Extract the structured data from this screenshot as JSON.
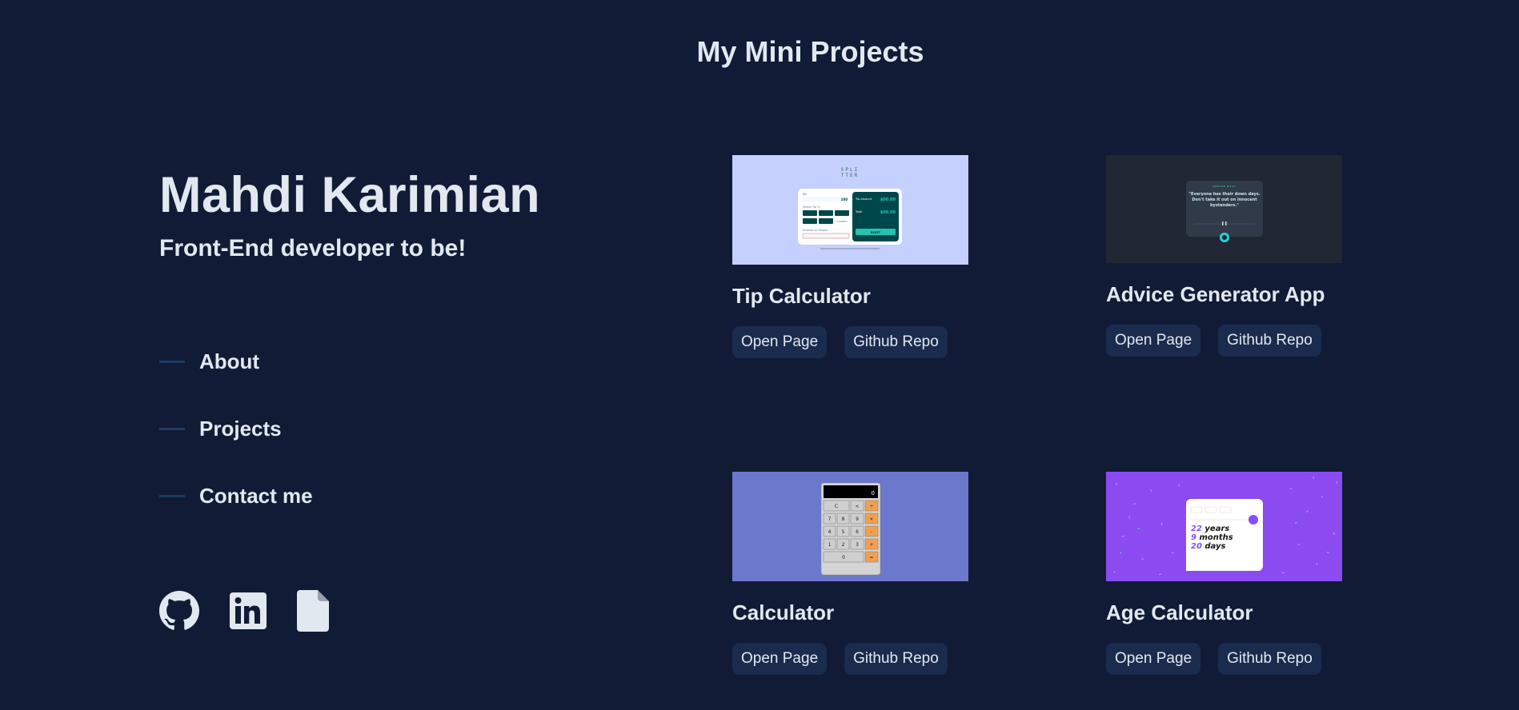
{
  "header": {
    "title": "My Mini Projects"
  },
  "profile": {
    "name": "Mahdi Karimian",
    "role": "Front-End developer to be!"
  },
  "nav": {
    "items": [
      {
        "label": "About"
      },
      {
        "label": "Projects"
      },
      {
        "label": "Contact me"
      }
    ]
  },
  "socials": {
    "icons": [
      "github-icon",
      "linkedin-icon",
      "document-icon"
    ]
  },
  "projects": [
    {
      "title": "Tip Calculator",
      "open_label": "Open Page",
      "repo_label": "Github Repo",
      "thumb": {
        "logo": "SPLI\nTTER",
        "bill_label": "Bill",
        "bill_value": "100",
        "tip_label": "Select Tip %",
        "people_label": "Number of People",
        "tip_amount_label": "Tip Amount",
        "tip_amount_value": "$00.00",
        "total_label": "Total",
        "total_value": "$00.00",
        "reset_label": "RESET",
        "custom_label": "Custom",
        "tips": [
          "5%",
          "10%",
          "15%",
          "25%",
          "50%"
        ]
      }
    },
    {
      "title": "Advice Generator App",
      "open_label": "Open Page",
      "repo_label": "Github Repo",
      "thumb": {
        "kicker": "ADVICE #117",
        "quote": "\"Everyone has their down days. Don't take it out on innocent bystanders.\""
      }
    },
    {
      "title": "Calculator",
      "open_label": "Open Page",
      "repo_label": "Github Repo",
      "thumb": {
        "display": "0",
        "keys": [
          [
            "C",
            "<",
            "÷"
          ],
          [
            "7",
            "8",
            "9",
            "×"
          ],
          [
            "4",
            "5",
            "6",
            "-"
          ],
          [
            "1",
            "2",
            "3",
            "+"
          ],
          [
            "0",
            "="
          ]
        ]
      }
    },
    {
      "title": "Age Calculator",
      "open_label": "Open Page",
      "repo_label": "Github Repo",
      "thumb": {
        "years_value": "22",
        "years_label": "years",
        "months_value": "9",
        "months_label": "months",
        "days_value": "20",
        "days_label": "days"
      }
    }
  ],
  "colors": {
    "background": "#111b36",
    "text": "#e2e8f0",
    "pill": "#1a2b4d",
    "nav_line": "#1e3a5f"
  }
}
